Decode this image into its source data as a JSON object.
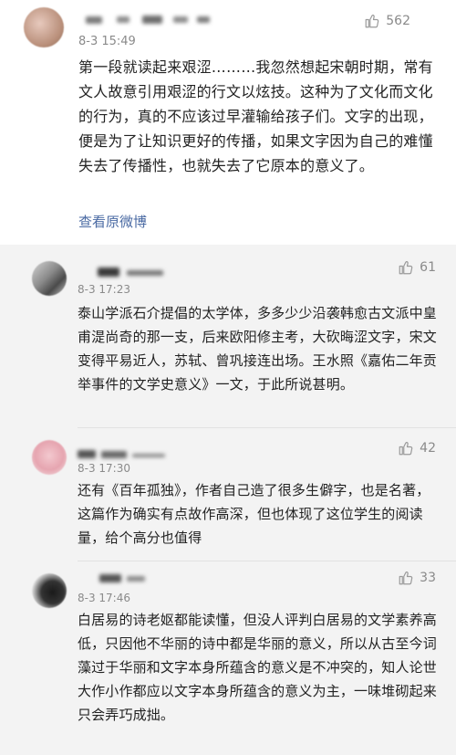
{
  "main_comment": {
    "time": "8-3 15:49",
    "likes": "562",
    "text": "第一段就读起来艰涩………我忽然想起宋朝时期，常有文人故意引用艰涩的行文以炫技。这种为了文化而文化的行为，真的不应该过早灌输给孩子们。文字的出现，便是为了让知识更好的传播，如果文字因为自己的难懂失去了传播性，也就失去了它原本的意义了。",
    "view_original": "查看原微博"
  },
  "replies": [
    {
      "time": "8-3 17:23",
      "likes": "61",
      "text": "泰山学派石介提倡的太学体，多多少少沿袭韩愈古文派中皇甫湜尚奇的那一支，后来欧阳修主考，大砍晦涩文字，宋文变得平易近人，苏轼、曾巩接连出场。王水照《嘉佑二年贡举事件的文学史意义》一文，于此所说甚明。"
    },
    {
      "time": "8-3 17:30",
      "likes": "42",
      "text": "还有《百年孤独》，作者自己造了很多生僻字，也是名著，这篇作为确实有点故作高深，但也体现了这位学生的阅读量，给个高分也值得"
    },
    {
      "time": "8-3 17:46",
      "likes": "33",
      "text": "白居易的诗老妪都能读懂，但没人评判白居易的文学素养高低，只因他不华丽的诗中都是华丽的意义，所以从古至今词藻过于华丽和文字本身所蕴含的意义是不冲突的，知人论世大作小作都应以文字本身所蕴含的意义为主，一味堆砌起来只会弄巧成拙。"
    }
  ],
  "icons": {
    "like": "thumb-up-icon"
  },
  "colors": {
    "link": "#4a6aa3",
    "meta": "#8a8a8a",
    "reply_bg": "#f3f3f3"
  }
}
